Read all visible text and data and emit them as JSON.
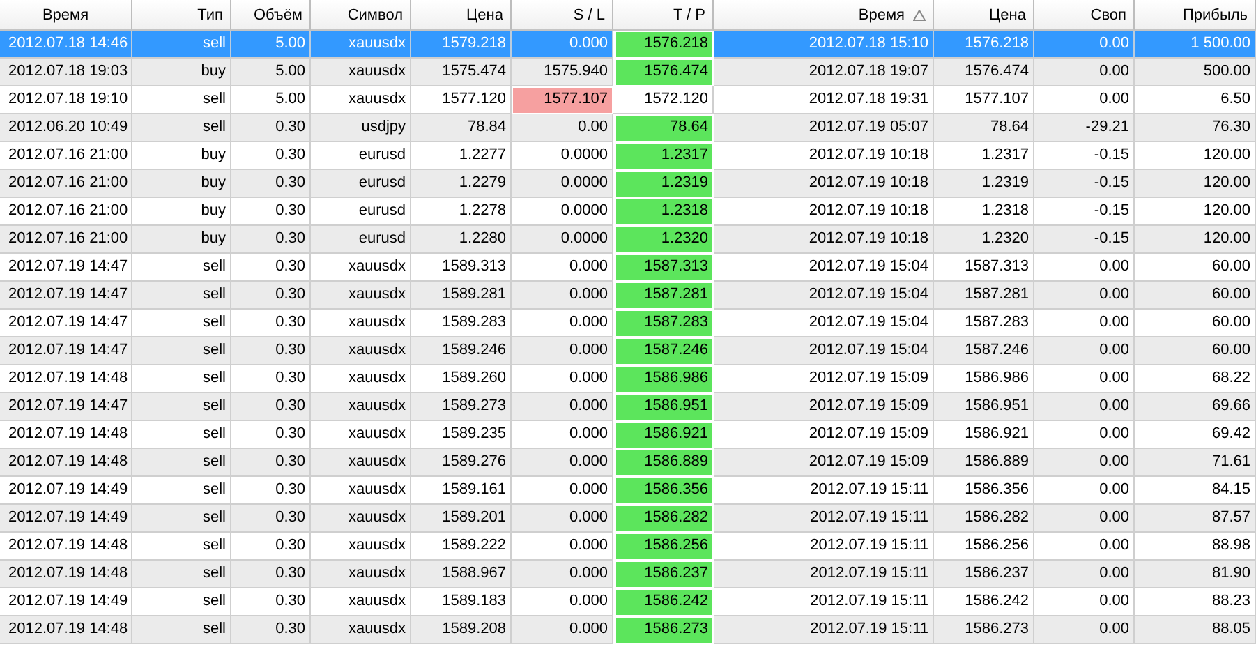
{
  "table": {
    "columns": [
      {
        "label": "Время",
        "sorted": false
      },
      {
        "label": "Тип",
        "sorted": false
      },
      {
        "label": "Объём",
        "sorted": false
      },
      {
        "label": "Символ",
        "sorted": false
      },
      {
        "label": "Цена",
        "sorted": false
      },
      {
        "label": "S / L",
        "sorted": false
      },
      {
        "label": "T / P",
        "sorted": false
      },
      {
        "label": "Время",
        "sorted": true
      },
      {
        "label": "Цена",
        "sorted": false
      },
      {
        "label": "Своп",
        "sorted": false
      },
      {
        "label": "Прибыль",
        "sorted": false
      }
    ],
    "rows": [
      {
        "selected": true,
        "sl_hit": false,
        "tp_hit": true,
        "cells": [
          "2012.07.18 14:46",
          "sell",
          "5.00",
          "xauusdx",
          "1579.218",
          "0.000",
          "1576.218",
          "2012.07.18 15:10",
          "1576.218",
          "0.00",
          "1 500.00"
        ]
      },
      {
        "selected": false,
        "sl_hit": false,
        "tp_hit": true,
        "cells": [
          "2012.07.18 19:03",
          "buy",
          "5.00",
          "xauusdx",
          "1575.474",
          "1575.940",
          "1576.474",
          "2012.07.18 19:07",
          "1576.474",
          "0.00",
          "500.00"
        ]
      },
      {
        "selected": false,
        "sl_hit": true,
        "tp_hit": false,
        "cells": [
          "2012.07.18 19:10",
          "sell",
          "5.00",
          "xauusdx",
          "1577.120",
          "1577.107",
          "1572.120",
          "2012.07.18 19:31",
          "1577.107",
          "0.00",
          "6.50"
        ]
      },
      {
        "selected": false,
        "sl_hit": false,
        "tp_hit": true,
        "cells": [
          "2012.06.20 10:49",
          "sell",
          "0.30",
          "usdjpy",
          "78.84",
          "0.00",
          "78.64",
          "2012.07.19 05:07",
          "78.64",
          "-29.21",
          "76.30"
        ]
      },
      {
        "selected": false,
        "sl_hit": false,
        "tp_hit": true,
        "cells": [
          "2012.07.16 21:00",
          "buy",
          "0.30",
          "eurusd",
          "1.2277",
          "0.0000",
          "1.2317",
          "2012.07.19 10:18",
          "1.2317",
          "-0.15",
          "120.00"
        ]
      },
      {
        "selected": false,
        "sl_hit": false,
        "tp_hit": true,
        "cells": [
          "2012.07.16 21:00",
          "buy",
          "0.30",
          "eurusd",
          "1.2279",
          "0.0000",
          "1.2319",
          "2012.07.19 10:18",
          "1.2319",
          "-0.15",
          "120.00"
        ]
      },
      {
        "selected": false,
        "sl_hit": false,
        "tp_hit": true,
        "cells": [
          "2012.07.16 21:00",
          "buy",
          "0.30",
          "eurusd",
          "1.2278",
          "0.0000",
          "1.2318",
          "2012.07.19 10:18",
          "1.2318",
          "-0.15",
          "120.00"
        ]
      },
      {
        "selected": false,
        "sl_hit": false,
        "tp_hit": true,
        "cells": [
          "2012.07.16 21:00",
          "buy",
          "0.30",
          "eurusd",
          "1.2280",
          "0.0000",
          "1.2320",
          "2012.07.19 10:18",
          "1.2320",
          "-0.15",
          "120.00"
        ]
      },
      {
        "selected": false,
        "sl_hit": false,
        "tp_hit": true,
        "cells": [
          "2012.07.19 14:47",
          "sell",
          "0.30",
          "xauusdx",
          "1589.313",
          "0.000",
          "1587.313",
          "2012.07.19 15:04",
          "1587.313",
          "0.00",
          "60.00"
        ]
      },
      {
        "selected": false,
        "sl_hit": false,
        "tp_hit": true,
        "cells": [
          "2012.07.19 14:47",
          "sell",
          "0.30",
          "xauusdx",
          "1589.281",
          "0.000",
          "1587.281",
          "2012.07.19 15:04",
          "1587.281",
          "0.00",
          "60.00"
        ]
      },
      {
        "selected": false,
        "sl_hit": false,
        "tp_hit": true,
        "cells": [
          "2012.07.19 14:47",
          "sell",
          "0.30",
          "xauusdx",
          "1589.283",
          "0.000",
          "1587.283",
          "2012.07.19 15:04",
          "1587.283",
          "0.00",
          "60.00"
        ]
      },
      {
        "selected": false,
        "sl_hit": false,
        "tp_hit": true,
        "cells": [
          "2012.07.19 14:47",
          "sell",
          "0.30",
          "xauusdx",
          "1589.246",
          "0.000",
          "1587.246",
          "2012.07.19 15:04",
          "1587.246",
          "0.00",
          "60.00"
        ]
      },
      {
        "selected": false,
        "sl_hit": false,
        "tp_hit": true,
        "cells": [
          "2012.07.19 14:48",
          "sell",
          "0.30",
          "xauusdx",
          "1589.260",
          "0.000",
          "1586.986",
          "2012.07.19 15:09",
          "1586.986",
          "0.00",
          "68.22"
        ]
      },
      {
        "selected": false,
        "sl_hit": false,
        "tp_hit": true,
        "cells": [
          "2012.07.19 14:47",
          "sell",
          "0.30",
          "xauusdx",
          "1589.273",
          "0.000",
          "1586.951",
          "2012.07.19 15:09",
          "1586.951",
          "0.00",
          "69.66"
        ]
      },
      {
        "selected": false,
        "sl_hit": false,
        "tp_hit": true,
        "cells": [
          "2012.07.19 14:48",
          "sell",
          "0.30",
          "xauusdx",
          "1589.235",
          "0.000",
          "1586.921",
          "2012.07.19 15:09",
          "1586.921",
          "0.00",
          "69.42"
        ]
      },
      {
        "selected": false,
        "sl_hit": false,
        "tp_hit": true,
        "cells": [
          "2012.07.19 14:48",
          "sell",
          "0.30",
          "xauusdx",
          "1589.276",
          "0.000",
          "1586.889",
          "2012.07.19 15:09",
          "1586.889",
          "0.00",
          "71.61"
        ]
      },
      {
        "selected": false,
        "sl_hit": false,
        "tp_hit": true,
        "cells": [
          "2012.07.19 14:49",
          "sell",
          "0.30",
          "xauusdx",
          "1589.161",
          "0.000",
          "1586.356",
          "2012.07.19 15:11",
          "1586.356",
          "0.00",
          "84.15"
        ]
      },
      {
        "selected": false,
        "sl_hit": false,
        "tp_hit": true,
        "cells": [
          "2012.07.19 14:49",
          "sell",
          "0.30",
          "xauusdx",
          "1589.201",
          "0.000",
          "1586.282",
          "2012.07.19 15:11",
          "1586.282",
          "0.00",
          "87.57"
        ]
      },
      {
        "selected": false,
        "sl_hit": false,
        "tp_hit": true,
        "cells": [
          "2012.07.19 14:48",
          "sell",
          "0.30",
          "xauusdx",
          "1589.222",
          "0.000",
          "1586.256",
          "2012.07.19 15:11",
          "1586.256",
          "0.00",
          "88.98"
        ]
      },
      {
        "selected": false,
        "sl_hit": false,
        "tp_hit": true,
        "cells": [
          "2012.07.19 14:48",
          "sell",
          "0.30",
          "xauusdx",
          "1588.967",
          "0.000",
          "1586.237",
          "2012.07.19 15:11",
          "1586.237",
          "0.00",
          "81.90"
        ]
      },
      {
        "selected": false,
        "sl_hit": false,
        "tp_hit": true,
        "cells": [
          "2012.07.19 14:49",
          "sell",
          "0.30",
          "xauusdx",
          "1589.183",
          "0.000",
          "1586.242",
          "2012.07.19 15:11",
          "1586.242",
          "0.00",
          "88.23"
        ]
      },
      {
        "selected": false,
        "sl_hit": false,
        "tp_hit": true,
        "cells": [
          "2012.07.19 14:48",
          "sell",
          "0.30",
          "xauusdx",
          "1589.208",
          "0.000",
          "1586.273",
          "2012.07.19 15:11",
          "1586.273",
          "0.00",
          "88.05"
        ]
      }
    ]
  }
}
